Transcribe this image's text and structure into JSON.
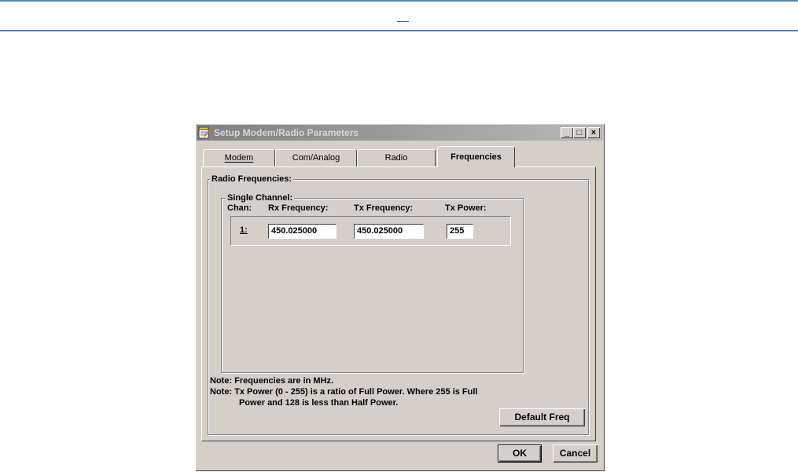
{
  "window": {
    "title": "Setup Modem/Radio Parameters",
    "min_glyph": "_",
    "max_glyph": "□",
    "close_glyph": "×"
  },
  "tabs": [
    {
      "label": "Modem",
      "active": false
    },
    {
      "label": "Com/Analog",
      "active": false
    },
    {
      "label": "Radio",
      "active": false
    },
    {
      "label": "Frequencies",
      "active": true
    }
  ],
  "radio_frequencies": {
    "group_label": "Radio Frequencies:",
    "single_channel": {
      "group_label": "Single Channel:",
      "headers": {
        "chan": "Chan:",
        "rx": "Rx Frequency:",
        "tx": "Tx Frequency:",
        "power": "Tx Power:"
      },
      "row": {
        "chan": "1:",
        "rx": "450.025000",
        "tx": "450.025000",
        "power": "255"
      }
    }
  },
  "notes": {
    "line1": "Note: Frequencies are in MHz.",
    "line2": "Note: Tx Power (0 - 255) is a ratio of Full Power.  Where 255 is Full",
    "line3": "Power and 128 is less than Half Power."
  },
  "buttons": {
    "default_freq": "Default Freq",
    "ok": "OK",
    "cancel": "Cancel"
  }
}
